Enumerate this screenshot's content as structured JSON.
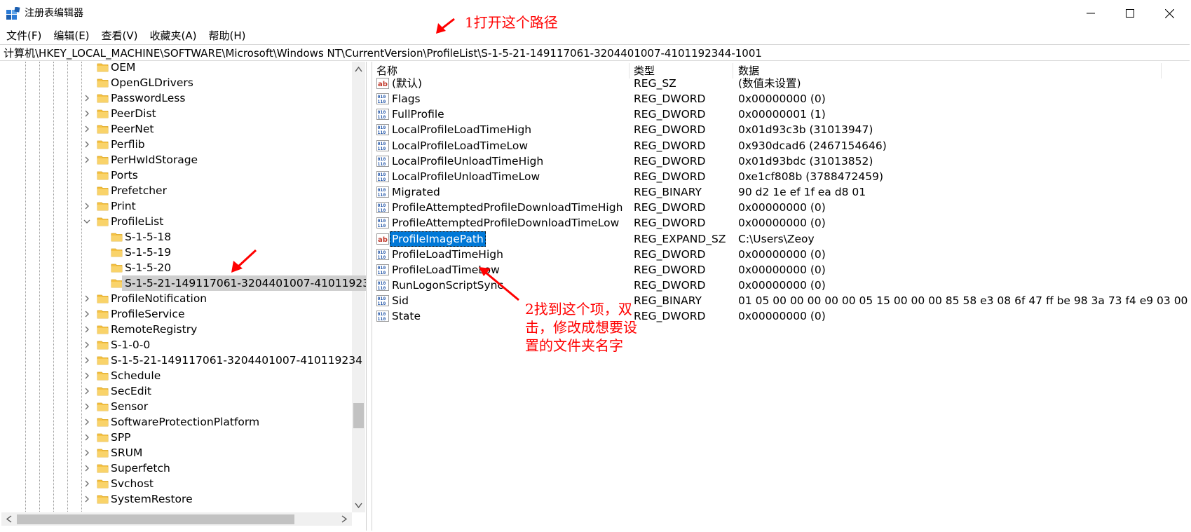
{
  "window": {
    "title": "注册表编辑器",
    "controls": {
      "minimize": "minimize",
      "maximize": "maximize",
      "close": "close"
    }
  },
  "menu": [
    "文件(F)",
    "编辑(E)",
    "查看(V)",
    "收藏夹(A)",
    "帮助(H)"
  ],
  "address": "计算机\\HKEY_LOCAL_MACHINE\\SOFTWARE\\Microsoft\\Windows NT\\CurrentVersion\\ProfileList\\S-1-5-21-149117061-3204401007-4101192344-1001",
  "tree": {
    "items": [
      {
        "label": "OEM",
        "level": 0,
        "expander": "none"
      },
      {
        "label": "OpenGLDrivers",
        "level": 0,
        "expander": "none"
      },
      {
        "label": "PasswordLess",
        "level": 0,
        "expander": "collapsed"
      },
      {
        "label": "PeerDist",
        "level": 0,
        "expander": "collapsed"
      },
      {
        "label": "PeerNet",
        "level": 0,
        "expander": "collapsed"
      },
      {
        "label": "Perflib",
        "level": 0,
        "expander": "collapsed"
      },
      {
        "label": "PerHwIdStorage",
        "level": 0,
        "expander": "collapsed"
      },
      {
        "label": "Ports",
        "level": 0,
        "expander": "none"
      },
      {
        "label": "Prefetcher",
        "level": 0,
        "expander": "none"
      },
      {
        "label": "Print",
        "level": 0,
        "expander": "collapsed"
      },
      {
        "label": "ProfileList",
        "level": 0,
        "expander": "expanded"
      },
      {
        "label": "S-1-5-18",
        "level": 1,
        "expander": "none"
      },
      {
        "label": "S-1-5-19",
        "level": 1,
        "expander": "none"
      },
      {
        "label": "S-1-5-20",
        "level": 1,
        "expander": "none"
      },
      {
        "label": "S-1-5-21-149117061-3204401007-41011923",
        "level": 1,
        "expander": "none",
        "selected": true
      },
      {
        "label": "ProfileNotification",
        "level": 0,
        "expander": "collapsed"
      },
      {
        "label": "ProfileService",
        "level": 0,
        "expander": "collapsed"
      },
      {
        "label": "RemoteRegistry",
        "level": 0,
        "expander": "collapsed"
      },
      {
        "label": "S-1-0-0",
        "level": 0,
        "expander": "collapsed"
      },
      {
        "label": "S-1-5-21-149117061-3204401007-410119234",
        "level": 0,
        "expander": "collapsed"
      },
      {
        "label": "Schedule",
        "level": 0,
        "expander": "collapsed"
      },
      {
        "label": "SecEdit",
        "level": 0,
        "expander": "collapsed"
      },
      {
        "label": "Sensor",
        "level": 0,
        "expander": "collapsed"
      },
      {
        "label": "SoftwareProtectionPlatform",
        "level": 0,
        "expander": "collapsed"
      },
      {
        "label": "SPP",
        "level": 0,
        "expander": "collapsed"
      },
      {
        "label": "SRUM",
        "level": 0,
        "expander": "collapsed"
      },
      {
        "label": "Superfetch",
        "level": 0,
        "expander": "collapsed"
      },
      {
        "label": "Svchost",
        "level": 0,
        "expander": "collapsed"
      },
      {
        "label": "SystemRestore",
        "level": 0,
        "expander": "collapsed"
      }
    ]
  },
  "values": {
    "columns": {
      "name": "名称",
      "type": "类型",
      "data": "数据"
    },
    "rows": [
      {
        "icon": "string-value-icon",
        "name": "(默认)",
        "type": "REG_SZ",
        "data": "(数值未设置)"
      },
      {
        "icon": "binary-value-icon",
        "name": "Flags",
        "type": "REG_DWORD",
        "data": "0x00000000 (0)"
      },
      {
        "icon": "binary-value-icon",
        "name": "FullProfile",
        "type": "REG_DWORD",
        "data": "0x00000001 (1)"
      },
      {
        "icon": "binary-value-icon",
        "name": "LocalProfileLoadTimeHigh",
        "type": "REG_DWORD",
        "data": "0x01d93c3b (31013947)"
      },
      {
        "icon": "binary-value-icon",
        "name": "LocalProfileLoadTimeLow",
        "type": "REG_DWORD",
        "data": "0x930dcad6 (2467154646)"
      },
      {
        "icon": "binary-value-icon",
        "name": "LocalProfileUnloadTimeHigh",
        "type": "REG_DWORD",
        "data": "0x01d93bdc (31013852)"
      },
      {
        "icon": "binary-value-icon",
        "name": "LocalProfileUnloadTimeLow",
        "type": "REG_DWORD",
        "data": "0xe1cf808b (3788472459)"
      },
      {
        "icon": "binary-value-icon",
        "name": "Migrated",
        "type": "REG_BINARY",
        "data": "90 d2 1e ef 1f ea d8 01"
      },
      {
        "icon": "binary-value-icon",
        "name": "ProfileAttemptedProfileDownloadTimeHigh",
        "type": "REG_DWORD",
        "data": "0x00000000 (0)"
      },
      {
        "icon": "binary-value-icon",
        "name": "ProfileAttemptedProfileDownloadTimeLow",
        "type": "REG_DWORD",
        "data": "0x00000000 (0)"
      },
      {
        "icon": "string-value-icon",
        "name": "ProfileImagePath",
        "type": "REG_EXPAND_SZ",
        "data": "C:\\Users\\Zeoy",
        "selected": true
      },
      {
        "icon": "binary-value-icon",
        "name": "ProfileLoadTimeHigh",
        "type": "REG_DWORD",
        "data": "0x00000000 (0)"
      },
      {
        "icon": "binary-value-icon",
        "name": "ProfileLoadTimeLow",
        "type": "REG_DWORD",
        "data": "0x00000000 (0)"
      },
      {
        "icon": "binary-value-icon",
        "name": "RunLogonScriptSync",
        "type": "REG_DWORD",
        "data": "0x00000000 (0)"
      },
      {
        "icon": "binary-value-icon",
        "name": "Sid",
        "type": "REG_BINARY",
        "data": "01 05 00 00 00 00 00 05 15 00 00 00 85 58 e3 08 6f 47 ff be 98 3a 73 f4 e9 03 00 00"
      },
      {
        "icon": "binary-value-icon",
        "name": "State",
        "type": "REG_DWORD",
        "data": "0x00000000 (0)"
      }
    ]
  },
  "annotations": {
    "step1": "1打开这个路径",
    "step2": "2找到这个项，双击，修改成想要设置的文件夹名字",
    "color": "#ff0000"
  },
  "colors": {
    "selection": "#0078d7",
    "folder": "#f6c243"
  }
}
